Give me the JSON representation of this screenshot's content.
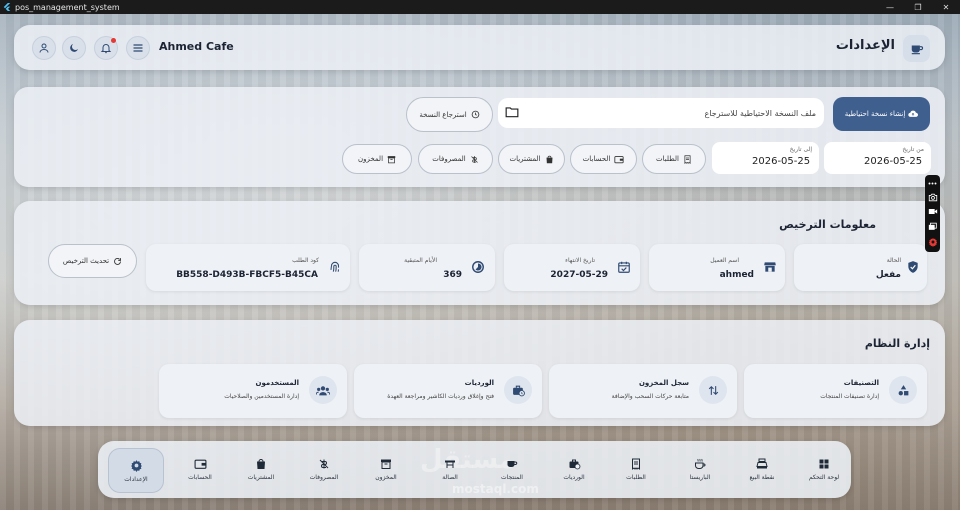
{
  "window": {
    "title": "pos_management_system",
    "controls": [
      "minimize",
      "maximize",
      "close"
    ]
  },
  "header": {
    "cafe_name": "Ahmed Cafe",
    "page_title": "الإعدادات",
    "icons": [
      "user-icon",
      "moon-icon",
      "bell-icon",
      "menu-icon",
      "coffee-icon"
    ]
  },
  "backup": {
    "create_button": "إنشاء نسخة احتياطية",
    "file_label": "ملف النسخة الاحتياطية للاسترجاع",
    "restore_button": "استرجاع النسخة",
    "from_date_label": "من تاريخ",
    "from_date": "2026-05-25",
    "to_date_label": "إلى تاريخ",
    "to_date": "2026-05-25",
    "report_buttons": [
      "الطلبات",
      "الحسابات",
      "المشتريات",
      "المصروفات",
      "المخزون"
    ]
  },
  "license": {
    "title": "معلومات الترخيص",
    "status_label": "الحالة",
    "status_value": "مفعل",
    "customer_label": "اسم العميل",
    "customer_value": "ahmed",
    "expiry_label": "تاريخ الانتهاء",
    "expiry_value": "2027-05-29",
    "remaining_label": "الأيام المتبقية",
    "remaining_value": "369",
    "request_code_label": "كود الطلب",
    "request_code_value": "BB558-D493B-FBCF5-B45CA",
    "refresh_button": "تحديث الترخيص"
  },
  "system": {
    "title": "إدارة النظام",
    "cards": [
      {
        "title": "التصنيفات",
        "desc": "إدارة تصنيفات المنتجات",
        "icon": "shapes-icon"
      },
      {
        "title": "سجل المخزون",
        "desc": "متابعة حركات السحب والإضافة",
        "icon": "swap-icon"
      },
      {
        "title": "الورديات",
        "desc": "فتح وإغلاق ورديات الكاشير ومراجعة العهدة",
        "icon": "briefcase-icon"
      },
      {
        "title": "المستخدمون",
        "desc": "إدارة المستخدمين والصلاحيات",
        "icon": "users-icon"
      }
    ]
  },
  "bottom_nav": {
    "items": [
      "لوحة التحكم",
      "نقطة البيع",
      "الباريستا",
      "الطلبات",
      "الورديات",
      "المنتجات",
      "الصالة",
      "المخزون",
      "المصروفات",
      "المشتريات",
      "الحسابات",
      "الإعدادات"
    ],
    "active": "الإعدادات"
  },
  "watermark": {
    "text": "مستقل",
    "url": "mostaql.com"
  },
  "colors": {
    "primary": "#3f5f8f",
    "icon": "#2f4a73",
    "notification": "#e53935"
  }
}
